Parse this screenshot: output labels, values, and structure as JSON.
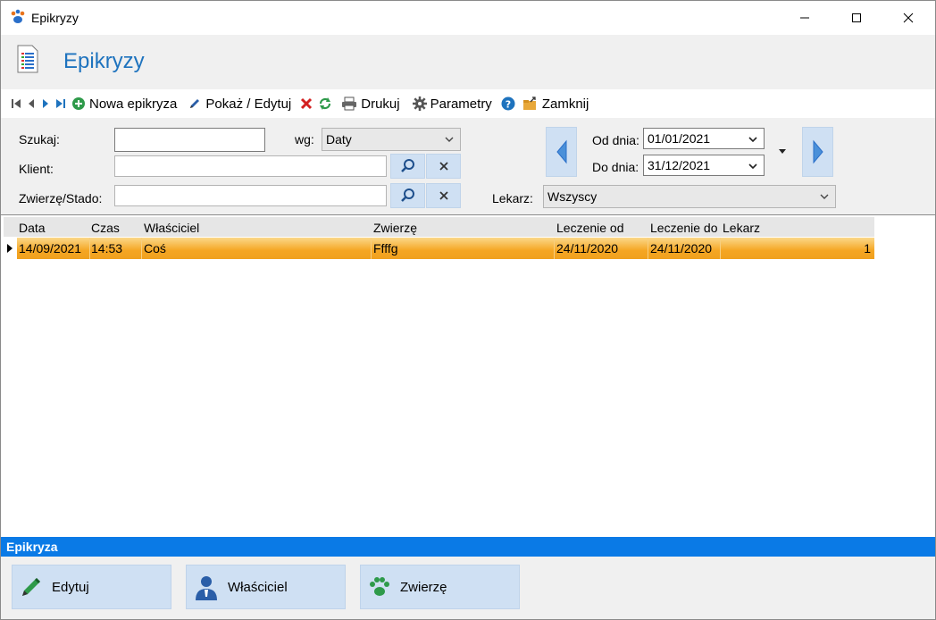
{
  "window": {
    "title": "Epikryzy"
  },
  "header": {
    "title": "Epikryzy"
  },
  "toolbar": {
    "new_label": "Nowa epikryza",
    "edit_label": "Pokaż / Edytuj",
    "print_label": "Drukuj",
    "params_label": "Parametry",
    "close_label": "Zamknij"
  },
  "filters": {
    "search_label": "Szukaj:",
    "search_value": "",
    "by_label": "wg:",
    "by_value": "Daty",
    "client_label": "Klient:",
    "client_value": "",
    "animal_label": "Zwierzę/Stado:",
    "animal_value": "",
    "from_label": "Od dnia:",
    "from_value": "01/01/2021",
    "to_label": "Do dnia:",
    "to_value": "31/12/2021",
    "doctor_label": "Lekarz:",
    "doctor_value": "Wszyscy"
  },
  "grid": {
    "columns": [
      "Data",
      "Czas",
      "Właściciel",
      "Zwierzę",
      "Leczenie od",
      "Leczenie do",
      "Lekarz"
    ],
    "rows": [
      {
        "data": "14/09/2021",
        "czas": "14:53",
        "wlasciciel": "Coś",
        "zwierze": "Ffffg",
        "leczenie_od": "24/11/2020",
        "leczenie_do": "24/11/2020",
        "lekarz": "1"
      }
    ]
  },
  "bottom": {
    "section_title": "Epikryza",
    "edit_label": "Edytuj",
    "owner_label": "Właściciel",
    "animal_label": "Zwierzę"
  },
  "colors": {
    "accent": "#1e73be",
    "section_bar": "#0a7ae6",
    "selected_row": "#f5a623",
    "button_bg": "#cfe0f3"
  }
}
